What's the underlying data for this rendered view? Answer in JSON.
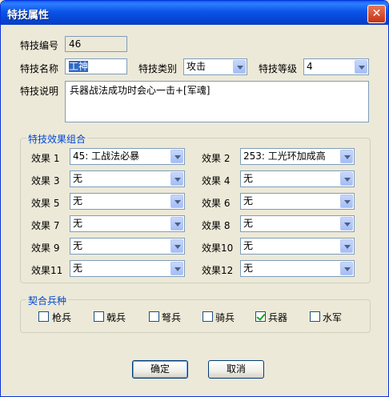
{
  "window": {
    "title": "特技属性",
    "close_label": "✕"
  },
  "fields": {
    "id_label": "特技编号",
    "id_value": "46",
    "name_label": "特技名称",
    "name_value": "工神",
    "type_label": "特技类别",
    "type_value": "攻击",
    "level_label": "特技等级",
    "level_value": "4",
    "desc_label": "特技说明",
    "desc_value": "兵器战法成功时会心一击+[军魂]"
  },
  "effects_group": {
    "title": "特技效果组合",
    "effects": [
      {
        "label": "效果 1",
        "value": "45: 工战法必暴"
      },
      {
        "label": "效果 2",
        "value": "253: 工光环加成高"
      },
      {
        "label": "效果 3",
        "value": "无"
      },
      {
        "label": "效果 4",
        "value": "无"
      },
      {
        "label": "效果 5",
        "value": "无"
      },
      {
        "label": "效果 6",
        "value": "无"
      },
      {
        "label": "效果 7",
        "value": "无"
      },
      {
        "label": "效果 8",
        "value": "无"
      },
      {
        "label": "效果 9",
        "value": "无"
      },
      {
        "label": "效果10",
        "value": "无"
      },
      {
        "label": "效果11",
        "value": "无"
      },
      {
        "label": "效果12",
        "value": "无"
      }
    ]
  },
  "troops_group": {
    "title": "契合兵种",
    "items": [
      {
        "label": "枪兵",
        "checked": false
      },
      {
        "label": "戟兵",
        "checked": false
      },
      {
        "label": "弩兵",
        "checked": false
      },
      {
        "label": "骑兵",
        "checked": false
      },
      {
        "label": "兵器",
        "checked": true
      },
      {
        "label": "水军",
        "checked": false
      }
    ]
  },
  "buttons": {
    "ok": "确定",
    "cancel": "取消"
  },
  "colors": {
    "titlebar": "#0a55e8",
    "group_title": "#0046d5",
    "dialog_bg": "#ece9d8"
  }
}
